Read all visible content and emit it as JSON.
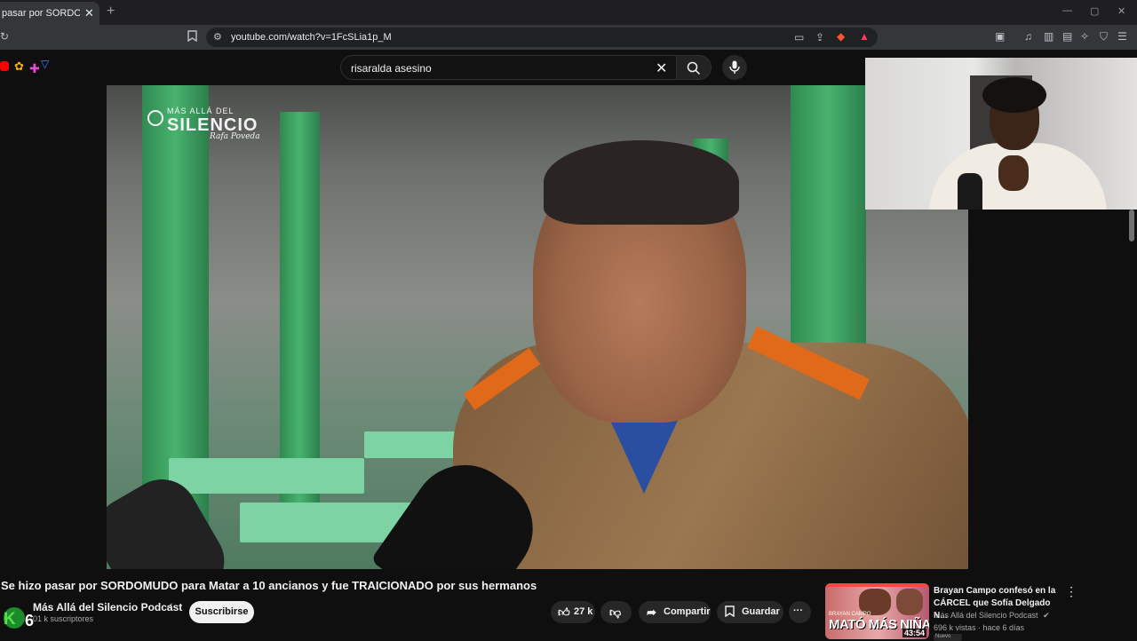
{
  "browser": {
    "tab_title": "pasar por SORDOMUDO",
    "tab_close": "✕",
    "new_tab": "+",
    "url": "youtube.com/watch?v=1FcSLia1p_M"
  },
  "youtube": {
    "search_query": "risaralda asesino",
    "clear": "✕",
    "video_watermark": {
      "line1": "MÁS ALLÁ DEL",
      "line2": "SILENCIO",
      "signature": "Rafa Poveda"
    },
    "video_title": "Se hizo pasar por SORDOMUDO para Matar a 10 ancianos y fue TRAICIONADO por sus hermanos",
    "channel": {
      "name": "Más Allá del Silencio Podcast",
      "subscribers": "01 k suscriptores",
      "avatar_letter": "K",
      "avatar_number": "6"
    },
    "subscribe_label": "Suscribirse",
    "actions": {
      "likes": "27 k",
      "share": "Compartir",
      "save": "Guardar",
      "more": "···"
    },
    "recommendation": {
      "title": "Brayan Campo confesó en la CÁRCEL que Sofía Delgado N...",
      "channel": "Más Allá del Silencio Podcast",
      "meta": "696 k vistas · hace 6 días",
      "duration": "43:54",
      "thumb_text": "MATÓ MÁS NIÑAS",
      "thumb_sub": "BRAYAN CAMPO",
      "badge": "Nuevo"
    }
  }
}
